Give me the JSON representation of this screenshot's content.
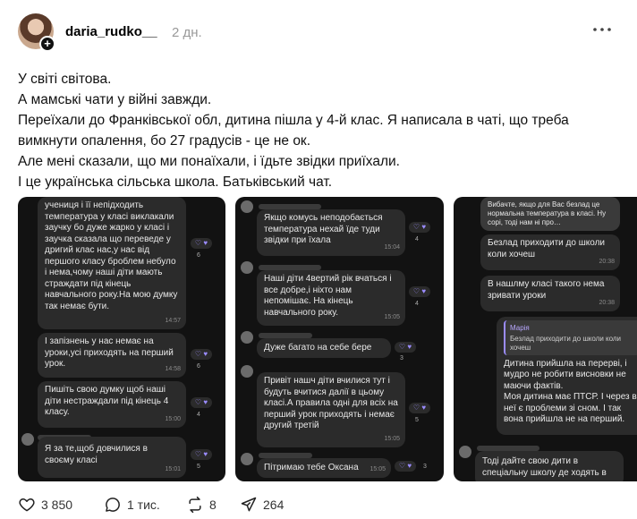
{
  "post": {
    "username": "daria_rudko__",
    "time": "2 дн.",
    "text": [
      "У світі світова.",
      "А мамські чати у війні завжди.",
      "Переїхали до Франківської обл, дитина пішла у 4-й клас. Я написала в чаті, що треба вимкнути опалення, бо 27 градусів - це не ок.",
      "Але мені сказали, що ми понаїхали, і їдьте звідки приїхали.",
      "І це українська сільська школа. Батьківський чат."
    ],
    "actions": {
      "likes": "3 850",
      "comments": "1 тис.",
      "reposts": "8",
      "shares": "264"
    }
  },
  "screenshots": [
    {
      "messages": [
        {
          "text": "учениця і її непідходить температура у класі виклакали заучку бо дуже жарко у класі і заучка сказала що переведе у дригий клас нас,у нас від першого класу броблем небуло і нема,чому наші діти мають страждати під кінець навчального року.На мою думку так немає бути.",
          "time": "14:57",
          "reaction_count": "6"
        },
        {
          "text": "І запізнень у нас немає на уроки,усі приходять на перший урок.",
          "time": "14:58",
          "reaction_count": "6"
        },
        {
          "text": "Пишіть свою думку щоб наші діти нестраждали під кінець 4 класу.",
          "time": "15:00",
          "reaction_count": "4"
        },
        {
          "text": "Я за те,щоб довчилися в своєму класі",
          "time": "15:01",
          "reaction_count": "5"
        }
      ]
    },
    {
      "messages": [
        {
          "text": "Якщо комусь неподобається температура нехай їде туди звідки при їхала",
          "time": "15:04",
          "reaction_count": "4"
        },
        {
          "text": "Наші діти 4вертий рік вчаться і все добре,і ніхто нам непомішає. На кінець навчального року.",
          "time": "15:05",
          "reaction_count": "4"
        },
        {
          "text": "Дуже багато на себе бере",
          "time": "15:05",
          "reaction_count": "3"
        },
        {
          "text": "Привіт нашч діти вчилися тут і будуть вчитися далії в цьому класі.А правила одні для всіх на перший урок приходять і немає другий третій",
          "time": "15:05",
          "reaction_count": "5"
        },
        {
          "text": "Пітримаю тебе Оксана",
          "time": "15:05",
          "reaction_count": "3"
        }
      ]
    },
    {
      "messages": [
        {
          "text": "Вибачте, якщо для Вас безлад це нормальна температура в класі. Ну сорі, тоді нам ні про…",
          "time": "",
          "reaction_count": ""
        },
        {
          "text": "Безлад приходити до школи коли хочеш",
          "time": "20:38",
          "reaction_count": ""
        },
        {
          "text": "В нашлму класі такого нема зривати уроки",
          "time": "20:38",
          "reaction_count": ""
        },
        {
          "quote_name": "Марія",
          "quote_text": "Безлад приходити до школи коли хочеш",
          "text": "Дитина прийшла на перерві, і мудро не робити висновки не маючи фактів.\nМоя дитина має ПТСР. І через в неї є проблеми зі сном. І так вона прийшла не на перший.",
          "time": "",
          "reaction_count": ""
        },
        {
          "text": "Тоді дайте свою дити в спеціальну школу де ходять в",
          "time": "",
          "reaction_count": ""
        }
      ]
    }
  ],
  "icons": {
    "avatar_plus": "plus-icon",
    "more": "more-icon",
    "like": "heart-icon",
    "comment": "comment-icon",
    "repost": "repost-icon",
    "share": "send-icon",
    "reaction": "heart-purple-icon"
  },
  "colors": {
    "reaction": "#9b8cff",
    "chat_bg": "#121212",
    "bubble_bg": "#2b2b2b"
  }
}
